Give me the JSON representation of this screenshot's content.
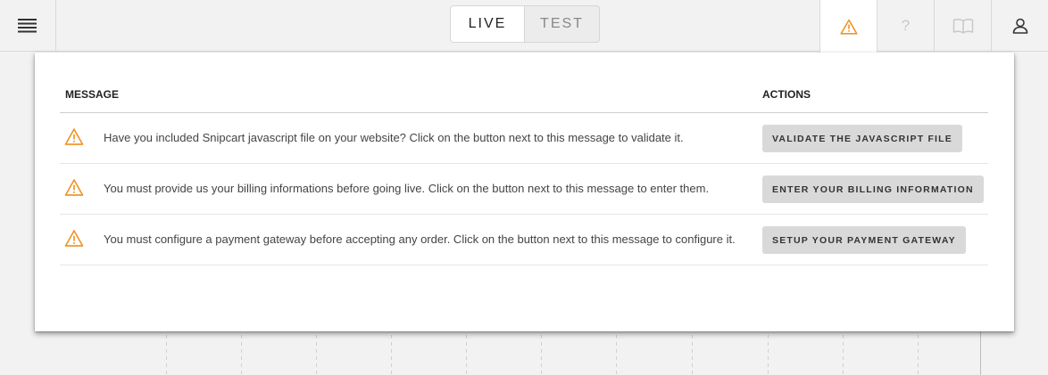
{
  "header": {
    "mode_switch": {
      "live_label": "LIVE",
      "test_label": "TEST",
      "selected": "LIVE"
    },
    "help_label": "?"
  },
  "colors": {
    "warning": "#f0962c",
    "inactive_icon": "#c8c8c8"
  },
  "panel": {
    "columns": {
      "message": "MESSAGE",
      "actions": "ACTIONS"
    },
    "rows": [
      {
        "message": "Have you included Snipcart javascript file on your website? Click on the button next to this message to validate it.",
        "action": "VALIDATE THE JAVASCRIPT FILE"
      },
      {
        "message": "You must provide us your billing informations before going live. Click on the button next to this message to enter them.",
        "action": "ENTER YOUR BILLING INFORMATION"
      },
      {
        "message": "You must configure a payment gateway before accepting any order. Click on the button next to this message to configure it.",
        "action": "SETUP YOUR PAYMENT GATEWAY"
      }
    ]
  }
}
